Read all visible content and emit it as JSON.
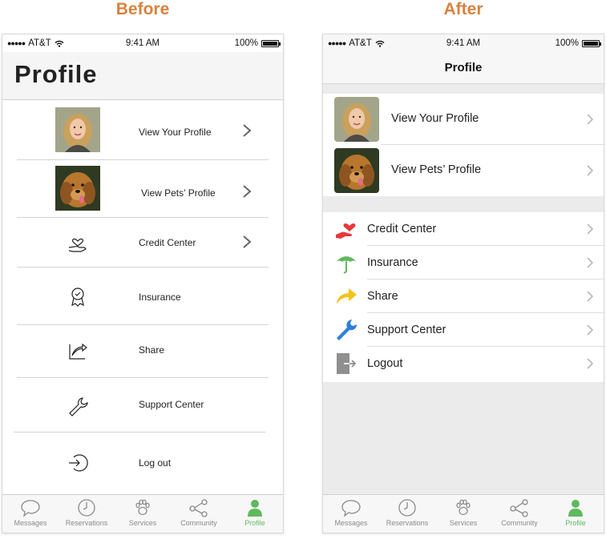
{
  "headings": {
    "before": "Before",
    "after": "After"
  },
  "status_bar": {
    "carrier": "AT&T",
    "time": "9:41 AM",
    "battery": "100%"
  },
  "before": {
    "title": "Profile",
    "items": [
      {
        "label": "View Your Profile",
        "thumb": "woman-photo",
        "chevron": true
      },
      {
        "label": "View Pets’ Profile",
        "thumb": "dog-photo",
        "chevron": true
      },
      {
        "label": "Credit Center",
        "icon": "hand-heart-icon",
        "chevron": true
      },
      {
        "label": "Insurance",
        "icon": "award-badge-icon",
        "chevron": false
      },
      {
        "label": "Share",
        "icon": "share-arrow-icon",
        "chevron": false
      },
      {
        "label": "Support Center",
        "icon": "wrench-icon",
        "chevron": false
      },
      {
        "label": "Log out",
        "icon": "logout-circle-icon",
        "chevron": false
      }
    ]
  },
  "after": {
    "title": "Profile",
    "profile_items": [
      {
        "label": "View Your Profile",
        "thumb": "woman-photo"
      },
      {
        "label": "View Pets’ Profile",
        "thumb": "dog-photo"
      }
    ],
    "menu_items": [
      {
        "label": "Credit Center",
        "icon": "hand-heart-icon",
        "color": "#e8373a"
      },
      {
        "label": "Insurance",
        "icon": "umbrella-icon",
        "color": "#5fb95e"
      },
      {
        "label": "Share",
        "icon": "share-arrow-icon",
        "color": "#f5c218"
      },
      {
        "label": "Support Center",
        "icon": "wrench-icon",
        "color": "#2f7fd8"
      },
      {
        "label": "Logout",
        "icon": "logout-door-icon",
        "color": "#8f8f8f"
      }
    ]
  },
  "tabs": [
    {
      "label": "Messages",
      "icon": "chat-bubble-icon"
    },
    {
      "label": "Reservations",
      "icon": "clock-icon"
    },
    {
      "label": "Services",
      "icon": "paw-icon"
    },
    {
      "label": "Community",
      "icon": "share-nodes-icon"
    },
    {
      "label": "Profile",
      "icon": "person-icon",
      "active": true
    }
  ],
  "colors": {
    "heading": "#d9813f",
    "active_tab": "#5fb95e",
    "tab_inactive": "#8a8a8a"
  }
}
